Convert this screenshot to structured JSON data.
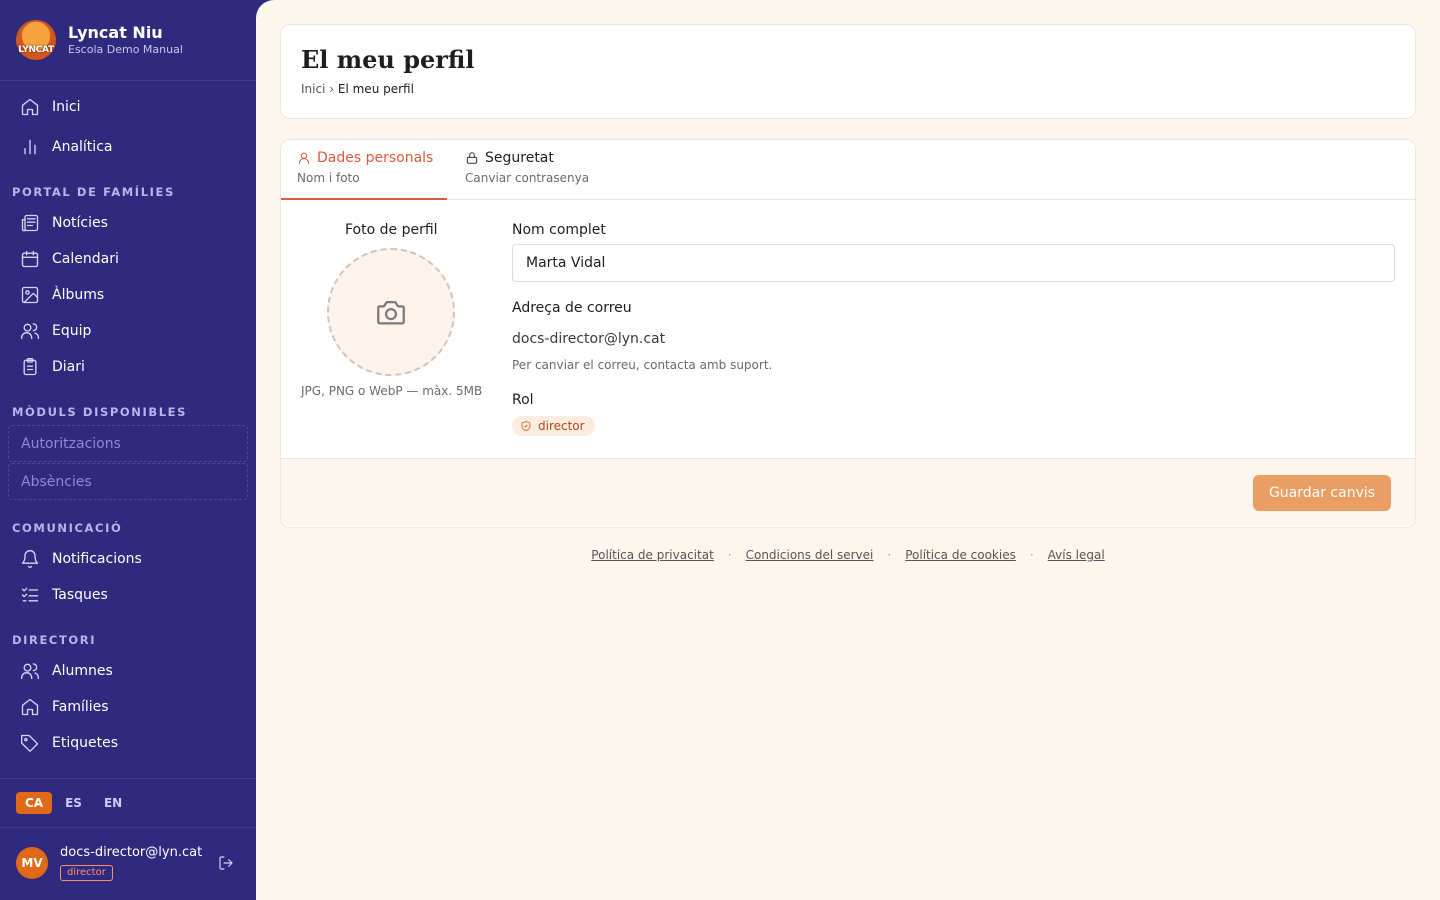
{
  "app": {
    "logo_text": "LYNCAT",
    "title": "Lyncat Niu",
    "subtitle": "Escola Demo Manual"
  },
  "sidebar": {
    "top_items": [
      {
        "label": "Inici",
        "icon": "home-icon"
      },
      {
        "label": "Analítica",
        "icon": "bar-chart-icon"
      }
    ],
    "sections": [
      {
        "title": "PORTAL DE FAMÍLIES",
        "items": [
          {
            "label": "Notícies",
            "icon": "newspaper-icon"
          },
          {
            "label": "Calendari",
            "icon": "calendar-icon"
          },
          {
            "label": "Àlbums",
            "icon": "image-icon"
          },
          {
            "label": "Equip",
            "icon": "users-icon"
          },
          {
            "label": "Diari",
            "icon": "clipboard-icon"
          }
        ]
      },
      {
        "title": "MÒDULS DISPONIBLES",
        "items": [
          {
            "label": "Autoritzacions"
          },
          {
            "label": "Absències"
          }
        ]
      },
      {
        "title": "COMUNICACIÓ",
        "items": [
          {
            "label": "Notificacions",
            "icon": "bell-icon"
          },
          {
            "label": "Tasques",
            "icon": "list-checks-icon"
          }
        ]
      },
      {
        "title": "DIRECTORI",
        "items": [
          {
            "label": "Alumnes",
            "icon": "users-icon"
          },
          {
            "label": "Famílies",
            "icon": "home-icon"
          },
          {
            "label": "Etiquetes",
            "icon": "tag-icon"
          }
        ]
      }
    ],
    "languages": [
      "CA",
      "ES",
      "EN"
    ],
    "active_language": "CA",
    "user": {
      "initials": "MV",
      "email": "docs-director@lyn.cat",
      "role": "director"
    }
  },
  "header": {
    "title": "El meu perfil",
    "breadcrumb_home": "Inici",
    "breadcrumb_sep": "›",
    "breadcrumb_current": "El meu perfil"
  },
  "tabs": [
    {
      "label": "Dades personals",
      "sub": "Nom i foto",
      "active": true
    },
    {
      "label": "Seguretat",
      "sub": "Canviar contrasenya",
      "active": false
    }
  ],
  "profile": {
    "photo_label": "Foto de perfil",
    "photo_hint": "JPG, PNG o WebP — màx. 5MB",
    "name_label": "Nom complet",
    "name_value": "Marta Vidal",
    "email_label": "Adreça de correu",
    "email_value": "docs-director@lyn.cat",
    "email_note": "Per canviar el correu, contacta amb suport.",
    "role_label": "Rol",
    "role_value": "director",
    "save_label": "Guardar canvis"
  },
  "footer": {
    "links": [
      "Política de privacitat",
      "Condicions del servei",
      "Política de cookies",
      "Avís legal"
    ],
    "separator": "·"
  },
  "colors": {
    "sidebar_bg": "#302a7f",
    "accent": "#e06a18",
    "tab_active": "#e05a3a",
    "save_button": "#ea9e63",
    "main_bg": "#fdf6ef"
  }
}
